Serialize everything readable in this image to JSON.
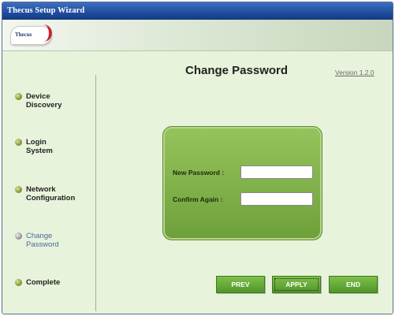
{
  "window": {
    "title": "Thecus Setup Wizard"
  },
  "logo": {
    "text": "Thecus"
  },
  "page": {
    "title": "Change Password",
    "version": "Version 1.2.0"
  },
  "steps": [
    {
      "line1": "Device",
      "line2": "Discovery",
      "active": false
    },
    {
      "line1": "Login",
      "line2": "System",
      "active": false
    },
    {
      "line1": "Network",
      "line2": "Configuration",
      "active": false
    },
    {
      "line1": "Change",
      "line2": "Password",
      "active": true
    },
    {
      "line1": "Complete",
      "line2": "",
      "active": false
    }
  ],
  "form": {
    "new_password_label": "New Password :",
    "new_password_value": "",
    "confirm_label": "Confirm Again :",
    "confirm_value": ""
  },
  "buttons": {
    "prev": "PREV",
    "apply": "APPLY",
    "end": "END"
  },
  "colors": {
    "accent": "#6ea03a",
    "title_bar": "#1f4d9e",
    "background": "#e8f3db"
  }
}
